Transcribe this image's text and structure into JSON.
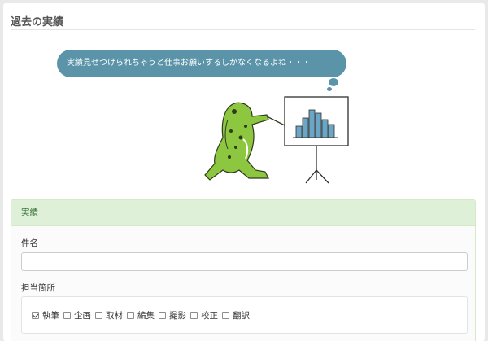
{
  "page": {
    "title": "過去の実績"
  },
  "speech_bubble": {
    "text": "実績見せつけられちゃうと仕事お願いするしかなくなるよね・・・"
  },
  "colors": {
    "accent": "#5b93a8",
    "panel_heading_bg": "#dff0d8",
    "panel_heading_text": "#3c763d",
    "frog_green": "#8dc63f",
    "chart_bar": "#6aa6c6"
  },
  "achievements_panel": {
    "heading": "実績",
    "name_label": "件名",
    "name_value": "",
    "name_placeholder": "",
    "roles_label": "担当箇所",
    "roles": [
      {
        "label": "執筆",
        "checked": true
      },
      {
        "label": "企画",
        "checked": false
      },
      {
        "label": "取材",
        "checked": false
      },
      {
        "label": "編集",
        "checked": false
      },
      {
        "label": "撮影",
        "checked": false
      },
      {
        "label": "校正",
        "checked": false
      },
      {
        "label": "翻訳",
        "checked": false
      }
    ]
  }
}
